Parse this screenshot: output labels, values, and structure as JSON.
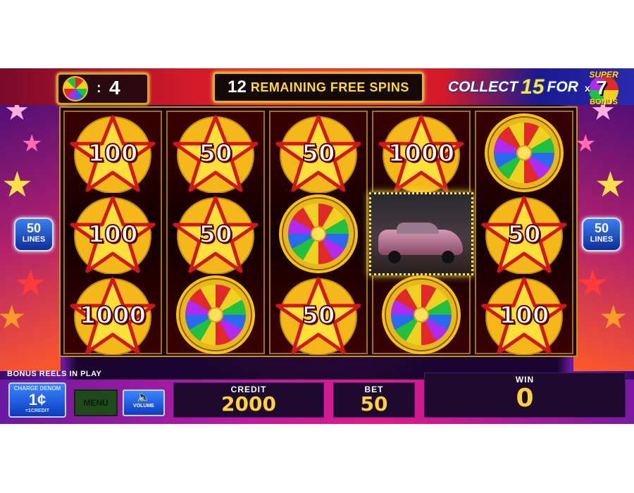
{
  "top": {
    "wheel_count_sep": ":",
    "wheel_count": "4",
    "free_spins_number": "12",
    "free_spins_text": "REMAINING FREE SPINS",
    "collect_prefix": "COLLECT",
    "collect_number": "15",
    "collect_suffix": "FOR",
    "super_badge": {
      "top": "SUPER",
      "x": "x",
      "multiplier": "7",
      "bottom": "BONUS"
    }
  },
  "side_lines": {
    "left_number": "50",
    "left_text": "LINES",
    "right_number": "50",
    "right_text": "LINES"
  },
  "reels": [
    [
      {
        "type": "star",
        "value": "100"
      },
      {
        "type": "star",
        "value": "100"
      },
      {
        "type": "star",
        "value": "1000"
      }
    ],
    [
      {
        "type": "star",
        "value": "50"
      },
      {
        "type": "star",
        "value": "50"
      },
      {
        "type": "wheel"
      }
    ],
    [
      {
        "type": "star",
        "value": "50"
      },
      {
        "type": "wheel"
      },
      {
        "type": "star",
        "value": "50"
      }
    ],
    [
      {
        "type": "star",
        "value": "1000"
      },
      {
        "type": "bonus-car"
      },
      {
        "type": "wheel"
      }
    ],
    [
      {
        "type": "wheel"
      },
      {
        "type": "star",
        "value": "50"
      },
      {
        "type": "star",
        "value": "100"
      }
    ]
  ],
  "bottom": {
    "bonus_reels_label": "BONUS REELS IN PLAY",
    "denom_top": "CHARGE DENOM",
    "denom_value": "1¢",
    "denom_sub": "=1CREDIT",
    "menu_label": "MENU",
    "volume_label": "VOLUME",
    "credit_label": "CREDIT",
    "credit_value": "2000",
    "bet_label": "BET",
    "bet_value": "50",
    "win_label": "WIN",
    "win_value": "0"
  },
  "icons": {
    "volume": "speaker-icon",
    "wheel": "color-wheel-icon",
    "star": "star-icon"
  },
  "colors": {
    "gold": "#e8b81a",
    "credit_text": "#ffd23a",
    "denom_blue": "#0b3cc0"
  }
}
